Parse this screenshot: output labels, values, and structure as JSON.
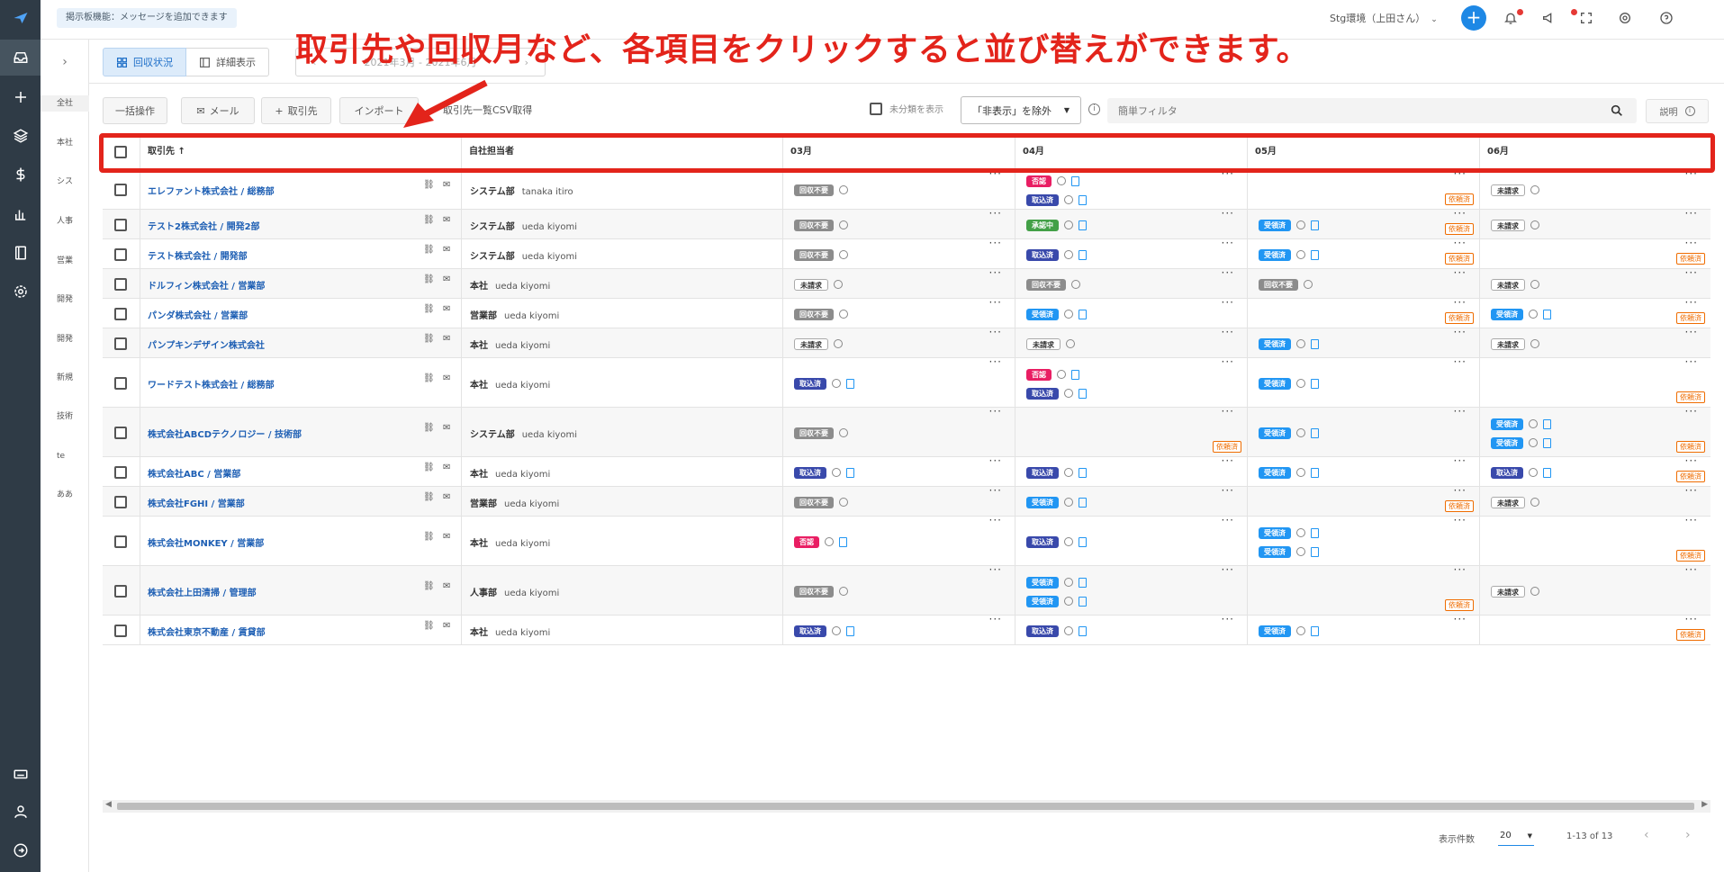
{
  "annotation": {
    "text": "取引先や回収月など、各項目をクリックすると並び替えができます。"
  },
  "topbar": {
    "bulletin": "掲示板機能：メッセージを追加できます",
    "environment": "Stg環境（上田さん）",
    "icons": [
      "plus-icon",
      "bell-icon",
      "megaphone-icon",
      "fullscreen-icon",
      "support-icon",
      "help-icon"
    ]
  },
  "rail": {
    "icons": [
      "logo-icon",
      "inbox-icon",
      "plus-icon",
      "layers-icon",
      "dollar-icon",
      "chart-icon",
      "book-icon",
      "settings-icon",
      "keyboard-icon",
      "user-icon",
      "logout-icon"
    ]
  },
  "subnav": {
    "items": [
      "全社",
      "本社",
      "シス",
      "人事",
      "営業",
      "開発",
      "開発",
      "新規",
      "技術",
      "te",
      "ああ"
    ]
  },
  "view": {
    "tab_collection": "回収状況",
    "tab_detail": "詳細表示",
    "month_range": "2021年3月 - 2021年6月"
  },
  "toolbar": {
    "bulk": "一括操作",
    "mail": "メール",
    "add_partner": "取引先",
    "import": "インポート",
    "csv": "取引先一覧CSV取得",
    "show_unclassified": "未分類を表示",
    "filter_select": "「非表示」を除外",
    "search_placeholder": "簡単フィルタ",
    "help": "説明"
  },
  "table": {
    "headers": {
      "partner": "取引先 ↑",
      "owner": "自社担当者",
      "m1": "03月",
      "m2": "04月",
      "m3": "05月",
      "m4": "06月"
    },
    "rows": [
      {
        "name": "エレファント株式会社 / 総務部",
        "dept": "システム部",
        "person": "tanaka itiro"
      },
      {
        "name": "テスト2株式会社 / 開発2部",
        "dept": "システム部",
        "person": "ueda kiyomi"
      },
      {
        "name": "テスト株式会社 / 開発部",
        "dept": "システム部",
        "person": "ueda kiyomi"
      },
      {
        "name": "ドルフィン株式会社 / 営業部",
        "dept": "本社",
        "person": "ueda kiyomi"
      },
      {
        "name": "パンダ株式会社 / 営業部",
        "dept": "営業部",
        "person": "ueda kiyomi"
      },
      {
        "name": "パンプキンデザイン株式会社",
        "dept": "本社",
        "person": "ueda kiyomi"
      },
      {
        "name": "ワードテスト株式会社 / 総務部",
        "dept": "本社",
        "person": "ueda kiyomi"
      },
      {
        "name": "株式会社ABCDテクノロジー / 技術部",
        "dept": "システム部",
        "person": "ueda kiyomi"
      },
      {
        "name": "株式会社ABC / 営業部",
        "dept": "本社",
        "person": "ueda kiyomi"
      },
      {
        "name": "株式会社FGHI / 営業部",
        "dept": "営業部",
        "person": "ueda kiyomi"
      },
      {
        "name": "株式会社MONKEY / 営業部",
        "dept": "本社",
        "person": "ueda kiyomi"
      },
      {
        "name": "株式会社上田清掃 / 管理部",
        "dept": "人事部",
        "person": "ueda kiyomi"
      },
      {
        "name": "株式会社東京不動産 / 賃貸部",
        "dept": "本社",
        "person": "ueda kiyomi"
      }
    ],
    "status_labels": {
      "fuyou": "回収不要",
      "torikomi": "取込済",
      "juryo": "受領済",
      "shonin": "承認中",
      "hikyaku": "否認",
      "miseikyu": "未請求",
      "irai": "依頼済"
    }
  },
  "footer": {
    "per_page_label": "表示件数",
    "per_page": "20",
    "range": "1-13 of 13"
  }
}
